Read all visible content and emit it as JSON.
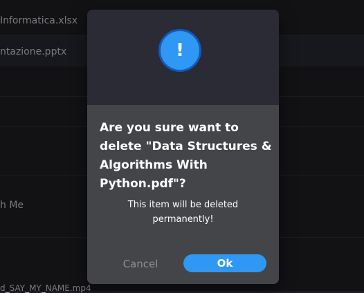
{
  "background_list": {
    "items": [
      {
        "label": "Informatica.xlsx"
      },
      {
        "label": "ntazione.pptx"
      },
      {
        "label": "h Me"
      },
      {
        "label": "d_SAY_MY_NAME.mp4"
      }
    ]
  },
  "dialog": {
    "icon": "exclamation-icon",
    "icon_glyph": "!",
    "question": "Are you sure want to delete \"Data Structures & Algorithms With Python.pdf\"?",
    "note": "This item will be deleted permanently!",
    "cancel_label": "Cancel",
    "ok_label": "Ok"
  },
  "colors": {
    "accent": "#2f97f4",
    "dialog_header": "#2a2b35",
    "dialog_body": "#444548",
    "background": "#1c1d21"
  }
}
